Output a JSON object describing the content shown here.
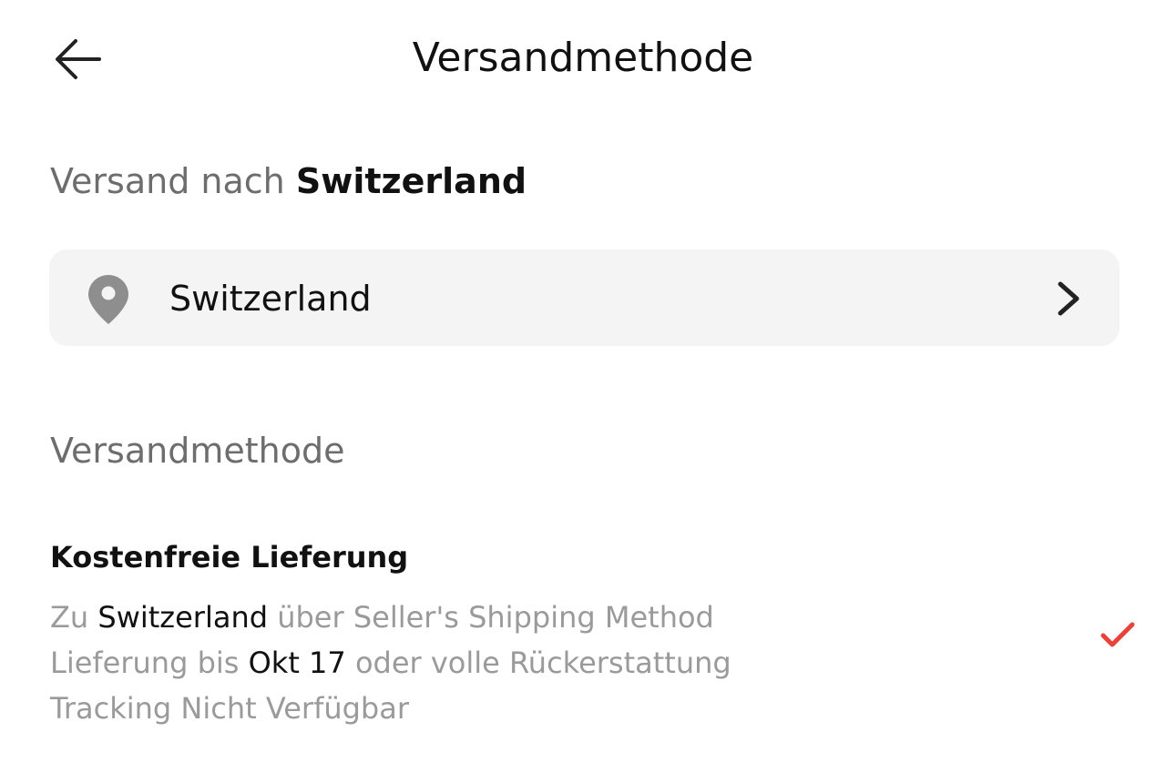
{
  "header": {
    "title": "Versandmethode",
    "back_icon": "arrow-left-icon"
  },
  "ship_to": {
    "prefix": "Versand nach",
    "country": "Switzerland"
  },
  "country_selector": {
    "icon": "location-pin-icon",
    "value": "Switzerland",
    "chevron_icon": "chevron-right-icon"
  },
  "section": {
    "label": "Versandmethode"
  },
  "shipping_option": {
    "title": "Kostenfreie Lieferung",
    "line1": {
      "prefix": "Zu",
      "country": "Switzerland",
      "suffix": "über Seller's Shipping Method"
    },
    "line2": {
      "prefix": "Lieferung bis",
      "date": "Okt 17",
      "suffix": "oder volle Rückerstattung"
    },
    "line3": "Tracking Nicht Verfügbar",
    "selected": true,
    "check_icon": "checkmark-icon"
  },
  "colors": {
    "accent": "#e8423a",
    "muted_text": "#9a9a9a",
    "secondary_text": "#6d6d6d",
    "primary_text": "#111111",
    "selector_bg": "#f4f4f4",
    "icon_gray": "#8e8e8e"
  }
}
